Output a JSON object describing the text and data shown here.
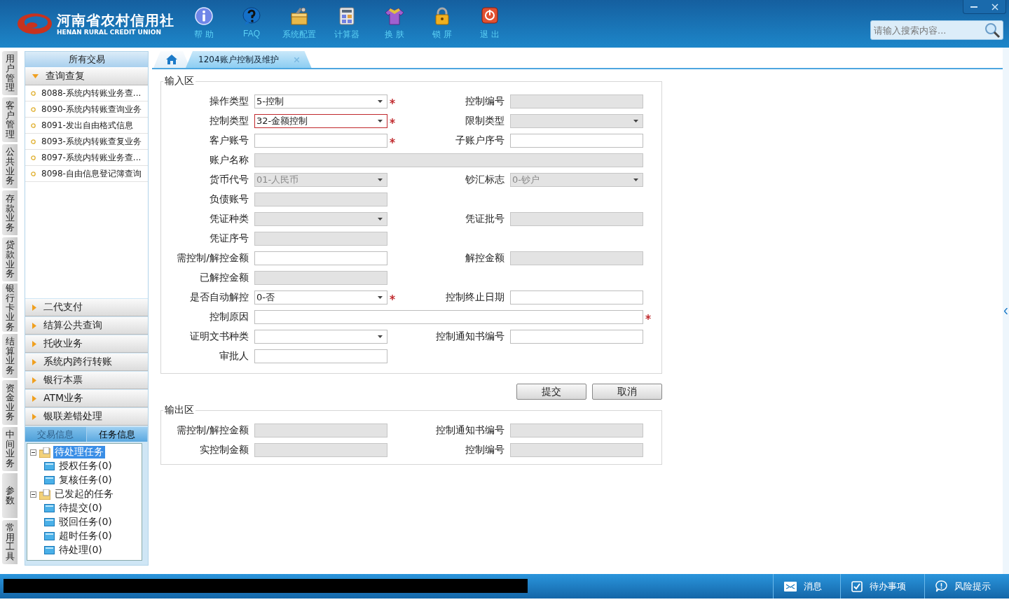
{
  "header": {
    "logo_title": "河南省农村信用社",
    "logo_subtitle": "HENAN RURAL CREDIT UNION",
    "nav": [
      {
        "kind": "help",
        "label": "帮 助"
      },
      {
        "kind": "faq",
        "label": "FAQ"
      },
      {
        "kind": "config",
        "label": "系统配置"
      },
      {
        "kind": "calculator",
        "label": "计算器"
      },
      {
        "kind": "skin",
        "label": "换 肤"
      },
      {
        "kind": "lock",
        "label": "锁 屏"
      },
      {
        "kind": "exit",
        "label": "退 出"
      }
    ],
    "search": {
      "placeholder": "请输入搜索内容..."
    }
  },
  "side_tabs": [
    "用户管理",
    "客户管理",
    "公共业务",
    "存款业务",
    "贷款业务",
    "银行卡业务",
    "结算业务",
    "资金业务",
    "中间业务",
    "参数",
    "常用工具"
  ],
  "sidebar": {
    "title": "所有交易",
    "groups": [
      {
        "label": "查询查复",
        "expanded": true,
        "items": [
          "8088-系统内转账业务查...",
          "8090-系统内转账查询业务",
          "8091-发出自由格式信息",
          "8093-系统内转账查复业务",
          "8097-系统内转账业务查...",
          "8098-自由信息登记簿查询"
        ]
      },
      {
        "label": "二代支付",
        "expanded": false
      },
      {
        "label": "结算公共查询",
        "expanded": false
      },
      {
        "label": "托收业务",
        "expanded": false
      },
      {
        "label": "系统内跨行转账",
        "expanded": false
      },
      {
        "label": "银行本票",
        "expanded": false
      },
      {
        "label": "ATM业务",
        "expanded": false
      },
      {
        "label": "银联差错处理",
        "expanded": false
      }
    ]
  },
  "task_panel": {
    "tabs": [
      {
        "label": "交易信息",
        "selected": false
      },
      {
        "label": "任务信息",
        "selected": true
      }
    ],
    "tree": [
      {
        "label": "待处理任务",
        "selected": true,
        "expanded": true,
        "children": [
          {
            "label": "授权任务(0)",
            "selected": false
          },
          {
            "label": "复核任务(0)",
            "selected": false
          }
        ]
      },
      {
        "label": "已发起的任务",
        "selected": false,
        "expanded": true,
        "children": [
          {
            "label": "待提交(0)",
            "selected": false
          },
          {
            "label": "驳回任务(0)",
            "selected": false
          },
          {
            "label": "超时任务(0)",
            "selected": false
          },
          {
            "label": "待处理(0)",
            "selected": false
          }
        ]
      }
    ]
  },
  "tabs": [
    {
      "kind": "home",
      "selected": false
    },
    {
      "kind": "page",
      "label": "1204账户控制及维护",
      "selected": true
    }
  ],
  "input_area": {
    "title": "输入区",
    "rows": [
      {
        "fields": [
          {
            "label": "操作类型",
            "kind": "select",
            "value": "5-控制",
            "disabled": false,
            "required": true,
            "highlighted": false
          },
          {
            "label": "控制编号",
            "kind": "text",
            "disabled": true,
            "required": false,
            "highlighted": false
          }
        ]
      },
      {
        "fields": [
          {
            "label": "控制类型",
            "kind": "select",
            "value": "32-金额控制",
            "disabled": false,
            "required": true,
            "highlighted": true
          },
          {
            "label": "限制类型",
            "kind": "select",
            "disabled": true,
            "required": false,
            "highlighted": false
          }
        ]
      },
      {
        "fields": [
          {
            "label": "客户账号",
            "kind": "text",
            "disabled": false,
            "required": true,
            "highlighted": false
          },
          {
            "label": "子账户序号",
            "kind": "text",
            "disabled": false,
            "required": false,
            "highlighted": false
          }
        ]
      },
      {
        "fields": [
          {
            "label": "账户名称",
            "kind": "text",
            "wide": true,
            "disabled": true,
            "required": false,
            "highlighted": false
          }
        ]
      },
      {
        "fields": [
          {
            "label": "货币代号",
            "kind": "select",
            "value": "01-人民币",
            "disabled": true,
            "required": false,
            "highlighted": false
          },
          {
            "label": "钞汇标志",
            "kind": "select",
            "value": "0-钞户",
            "disabled": true,
            "required": false,
            "highlighted": false
          }
        ]
      },
      {
        "fields": [
          {
            "label": "负债账号",
            "kind": "text",
            "disabled": true,
            "required": false,
            "highlighted": false
          }
        ]
      },
      {
        "fields": [
          {
            "label": "凭证种类",
            "kind": "select",
            "disabled": true,
            "required": false,
            "highlighted": false
          },
          {
            "label": "凭证批号",
            "kind": "text",
            "disabled": true,
            "required": false,
            "highlighted": false
          }
        ]
      },
      {
        "fields": [
          {
            "label": "凭证序号",
            "kind": "text",
            "disabled": true,
            "required": false,
            "highlighted": false
          }
        ]
      },
      {
        "fields": [
          {
            "label": "需控制/解控金额",
            "kind": "text",
            "disabled": false,
            "required": false,
            "highlighted": false
          },
          {
            "label": "解控金额",
            "kind": "text",
            "disabled": true,
            "required": false,
            "highlighted": false
          }
        ]
      },
      {
        "fields": [
          {
            "label": "已解控金额",
            "kind": "text",
            "disabled": true,
            "required": false,
            "highlighted": false
          }
        ]
      },
      {
        "fields": [
          {
            "label": "是否自动解控",
            "kind": "select",
            "value": "0-否",
            "disabled": false,
            "required": true,
            "highlighted": false
          },
          {
            "label": "控制终止日期",
            "kind": "text",
            "disabled": false,
            "required": false,
            "highlighted": false
          }
        ]
      },
      {
        "fields": [
          {
            "label": "控制原因",
            "kind": "text",
            "wide": true,
            "disabled": false,
            "required": true,
            "highlighted": false
          }
        ]
      },
      {
        "fields": [
          {
            "label": "证明文书种类",
            "kind": "select",
            "disabled": false,
            "required": false,
            "highlighted": false
          },
          {
            "label": "控制通知书编号",
            "kind": "text",
            "disabled": false,
            "required": false,
            "highlighted": false
          }
        ]
      },
      {
        "fields": [
          {
            "label": "审批人",
            "kind": "text",
            "disabled": false,
            "required": false,
            "highlighted": false
          }
        ]
      }
    ]
  },
  "buttons": [
    "提交",
    "取消"
  ],
  "output_area": {
    "title": "输出区",
    "rows": [
      {
        "fields": [
          {
            "label": "需控制/解控金额",
            "kind": "text",
            "disabled": true,
            "required": false,
            "highlighted": false
          },
          {
            "label": "控制通知书编号",
            "kind": "text",
            "disabled": true,
            "required": false,
            "highlighted": false
          }
        ]
      },
      {
        "fields": [
          {
            "label": "实控制金额",
            "kind": "text",
            "disabled": true,
            "required": false,
            "highlighted": false
          },
          {
            "label": "控制编号",
            "kind": "text",
            "disabled": true,
            "required": false,
            "highlighted": false
          }
        ]
      }
    ]
  },
  "status_bar": {
    "items": [
      {
        "kind": "message",
        "label": "消息"
      },
      {
        "kind": "todo",
        "label": "待办事项"
      },
      {
        "kind": "risk",
        "label": "风险提示"
      }
    ]
  }
}
